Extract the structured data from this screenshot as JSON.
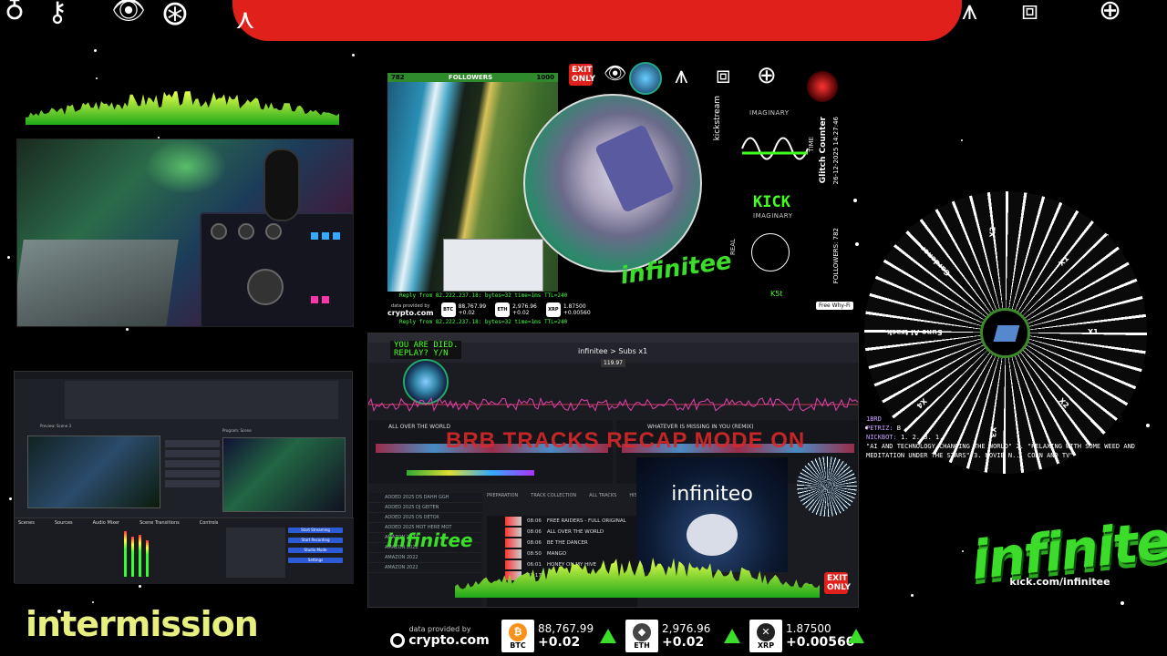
{
  "overlay": {
    "followers_label": "FOLLOWERS",
    "followers_left": "782",
    "followers_right": "1000",
    "exit_only": "EXIT ONLY",
    "imaginary": "IMAGINARY",
    "imaginary2": "IMAGINARY",
    "real": "REAL",
    "time": "TIME",
    "kick": "KICK",
    "glitch_counter": "Glitch Counter",
    "date": "26-12-2025 14:27:46",
    "followers_vertical": "FOLLOWERS: 782",
    "ping1": "Reply from 82.222.237.18: bytes=32 time=1ms TTL=240",
    "ping2": "Reply from 82.222.237.18: bytes=32 time=1ms TTL=240",
    "free_why": "Free Why-Fi",
    "kst": "K5t",
    "data_provided_small": "data provided by",
    "cryptocom_small": "crypto.com"
  },
  "dj": {
    "died_line1": "YOU ARE DIED.",
    "died_line2": "REPLAY? Y/N",
    "breadcrumb": "infinitee > Subs x1",
    "bpm": "119.97",
    "deck_a_title": "ALL OVER THE WORLD",
    "deck_b_title": "WHATEVER IS MISSING IN YOU (REMIX)",
    "recap_banner": "BRB TRACKS RECAP MODE ON",
    "infiniteo": "infiniteo",
    "tabs": [
      "PREPARATION",
      "TRACK COLLECTION",
      "ALL TRACKS",
      "HISTORY"
    ],
    "library": [
      "ADDED 2025 DS DAHH GGH",
      "ADDED 2025 DJ GEITEN",
      "ADDED 2025 DS DETOX",
      "ADDED 2025 MOT HERE MOT",
      "AMAZON 2022",
      "AMAZON 2022",
      "AMAZON 2022",
      "AMAZON 2022"
    ],
    "tracks": [
      {
        "time": "08:06",
        "title": "FREE RAIDERS - FULL ORIGINAL"
      },
      {
        "time": "08:06",
        "title": "ALL OVER THE WORLD"
      },
      {
        "time": "08:06",
        "title": "BE THE DANCER"
      },
      {
        "time": "08:50",
        "title": "MANGO"
      },
      {
        "time": "06:01",
        "title": "HONEY ON MY HIVE"
      },
      {
        "time": "02:17",
        "title": "ARE DE TRIOMPHE"
      }
    ],
    "exit_only": "EXIT ONLY"
  },
  "obs": {
    "preview_label": "Preview: Scene 3",
    "program_label": "Program: Scene",
    "dock_labels": [
      "Scenes",
      "Sources",
      "Audio Mixer",
      "Scene Transitions",
      "Controls"
    ],
    "buttons": [
      "Start Streaming",
      "Start Recording",
      "Studio Mode",
      "Settings"
    ]
  },
  "chat": {
    "lines": [
      {
        "user": "1BRD",
        "text": ""
      },
      {
        "user": "PETRIZ:",
        "text": "B"
      },
      {
        "user": "NICKBOT:",
        "text": "1. 2. 3. 1."
      },
      {
        "user": "",
        "text": "\"AI AND TECHNOLOGY CHANGING THE WORLD\" 2. \"RELAXING WITH SOME WEED AND MEDITATION UNDER THE STARS\" 3. MOVIE N... CORN AND TV\""
      }
    ]
  },
  "wheel": {
    "labels": [
      "X1",
      "X2",
      "X3",
      "X4",
      "Suno AI track",
      "Gardener",
      "X2",
      "X1"
    ]
  },
  "brand": {
    "word": "infinitee",
    "url": "kick.com/infinitee"
  },
  "intermission": "intermission",
  "ticker": {
    "provided_by": "data provided by",
    "provider": "crypto.com",
    "coins": [
      {
        "symbol": "BTC",
        "price": "88,767.99",
        "change": "+0.02",
        "color": "#f7931a",
        "glyph": "₿"
      },
      {
        "symbol": "ETH",
        "price": "2,976.96",
        "change": "+0.02",
        "color": "#444",
        "glyph": "◆"
      },
      {
        "symbol": "XRP",
        "price": "1.87500",
        "change": "+0.00560",
        "color": "#222",
        "glyph": "✕"
      }
    ],
    "up_color": "#3bdc2a"
  }
}
